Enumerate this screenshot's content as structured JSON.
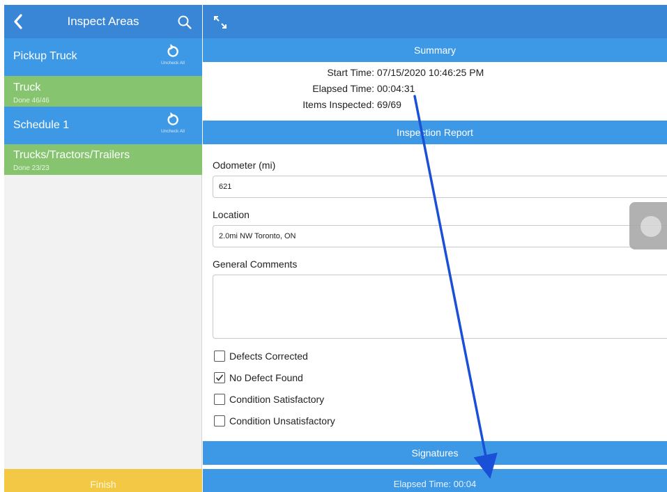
{
  "left_panel": {
    "title": "Inspect Areas",
    "areas": [
      {
        "label": "Pickup Truck",
        "sublabel": "",
        "status": "header",
        "action_label": "Uncheck All"
      },
      {
        "label": "Truck",
        "sublabel": "Done 46/46",
        "status": "done"
      },
      {
        "label": "Schedule 1",
        "sublabel": "",
        "status": "header",
        "action_label": "Uncheck All"
      },
      {
        "label": "Trucks/Tractors/Trailers",
        "sublabel": "Done 23/23",
        "status": "done"
      }
    ],
    "finish_label": "Finish"
  },
  "summary": {
    "title": "Summary",
    "start_time_label": "Start Time:",
    "start_time": "07/15/2020 10:46:25 PM",
    "elapsed_time_label": "Elapsed Time:",
    "elapsed_time": "00:04:31",
    "items_inspected_label": "Items Inspected:",
    "items_inspected": "69/69"
  },
  "report": {
    "title": "Inspection Report",
    "odometer_label": "Odometer (mi)",
    "odometer_value": "621",
    "location_label": "Location",
    "location_value": "2.0mi NW Toronto, ON",
    "comments_label": "General Comments",
    "comments_value": "",
    "checkboxes": [
      {
        "label": "Defects Corrected",
        "checked": false
      },
      {
        "label": "No Defect Found",
        "checked": true
      },
      {
        "label": "Condition Satisfactory",
        "checked": false
      },
      {
        "label": "Condition Unsatisfactory",
        "checked": false
      }
    ]
  },
  "signatures": {
    "title": "Signatures"
  },
  "status_bar": {
    "text": "Elapsed Time: 00:04"
  },
  "colors": {
    "header_blue": "#3a86d6",
    "section_blue": "#3d99e6",
    "done_green": "#86c470",
    "finish_yellow": "#f2c845",
    "annotation_arrow": "#1a4fd8"
  },
  "icons": {
    "back": "chevron-left-icon",
    "search": "search-icon",
    "expand": "expand-icon",
    "uncheck": "undo-icon",
    "assist": "assistive-touch-icon"
  }
}
